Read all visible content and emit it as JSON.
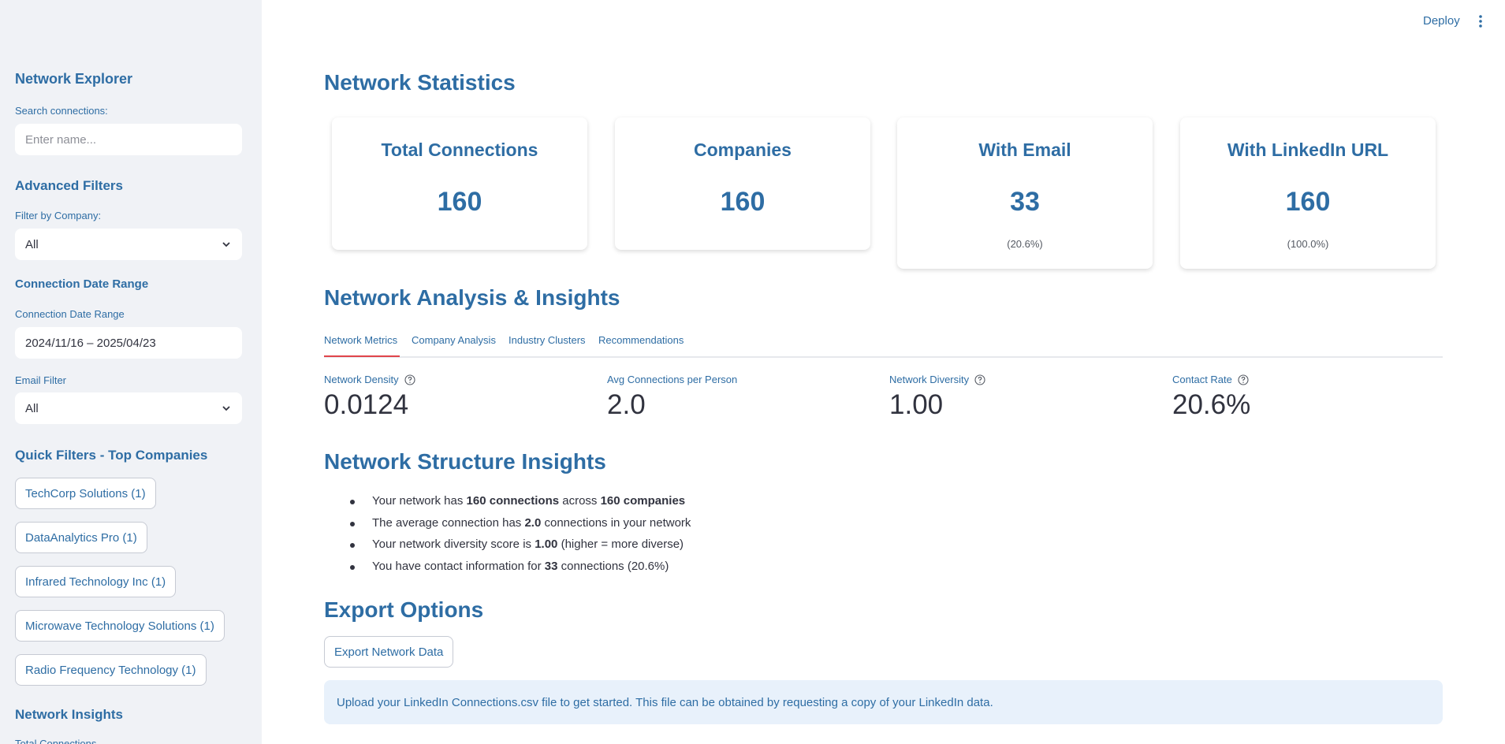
{
  "header": {
    "deploy_label": "Deploy"
  },
  "sidebar": {
    "network_explorer_title": "Network Explorer",
    "search_label": "Search connections:",
    "search_placeholder": "Enter name...",
    "advanced_filters_title": "Advanced Filters",
    "company_filter_label": "Filter by Company:",
    "company_filter_value": "All",
    "date_range_title": "Connection Date Range",
    "date_range_label": "Connection Date Range",
    "date_range_value": "2024/11/16 – 2025/04/23",
    "email_filter_label": "Email Filter",
    "email_filter_value": "All",
    "quick_filters_title": "Quick Filters - Top Companies",
    "quick_filters": [
      "TechCorp Solutions (1)",
      "DataAnalytics Pro (1)",
      "Infrared Technology Inc (1)",
      "Microwave Technology Solutions (1)",
      "Radio Frequency Technology (1)"
    ],
    "network_insights_title": "Network Insights",
    "network_insights_first_item": "Total Connections"
  },
  "stats": {
    "title": "Network Statistics",
    "cards": [
      {
        "title": "Total Connections",
        "value": "160",
        "sub": ""
      },
      {
        "title": "Companies",
        "value": "160",
        "sub": ""
      },
      {
        "title": "With Email",
        "value": "33",
        "sub": "(20.6%)"
      },
      {
        "title": "With LinkedIn URL",
        "value": "160",
        "sub": "(100.0%)"
      }
    ]
  },
  "analysis": {
    "title": "Network Analysis & Insights",
    "tabs": [
      "Network Metrics",
      "Company Analysis",
      "Industry Clusters",
      "Recommendations"
    ],
    "metrics": [
      {
        "label": "Network Density",
        "value": "0.0124"
      },
      {
        "label": "Avg Connections per Person",
        "value": "2.0"
      },
      {
        "label": "Network Diversity",
        "value": "1.00"
      },
      {
        "label": "Contact Rate",
        "value": "20.6%"
      }
    ]
  },
  "structure": {
    "title": "Network Structure Insights",
    "b1": {
      "a": "Your network has ",
      "b": "160 connections",
      "c": " across ",
      "d": "160 companies"
    },
    "b2": {
      "a": "The average connection has ",
      "b": "2.0",
      "c": " connections in your network"
    },
    "b3": {
      "a": "Your network diversity score is ",
      "b": "1.00",
      "c": " (higher = more diverse)"
    },
    "b4": {
      "a": "You have contact information for ",
      "b": "33",
      "c": " connections (20.6%)"
    }
  },
  "export": {
    "title": "Export Options",
    "button_label": "Export Network Data",
    "info_text": "Upload your LinkedIn Connections.csv file to get started. This file can be obtained by requesting a copy of your LinkedIn data."
  },
  "colors": {
    "accent": "#2e6da4",
    "sidebar_bg": "#f0f2f6",
    "tab_active": "#e0454b",
    "info_bg": "#e8f1fb"
  }
}
